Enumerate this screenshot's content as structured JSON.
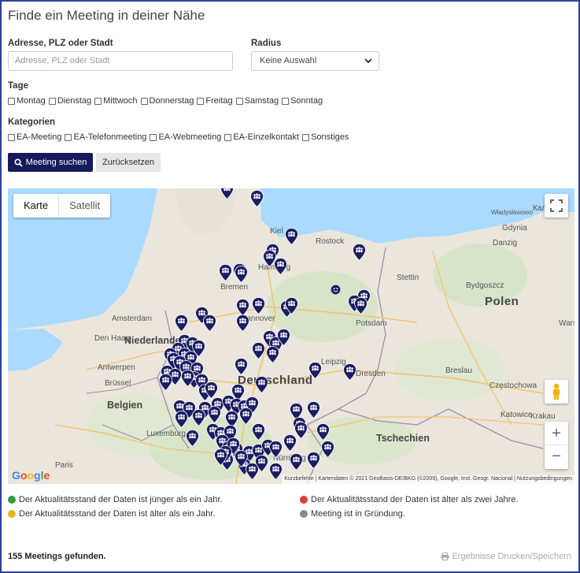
{
  "page": {
    "title": "Finde ein Meeting in deiner Nähe"
  },
  "form": {
    "address_label": "Adresse, PLZ oder Stadt",
    "address_placeholder": "Adresse, PLZ oder Stadt",
    "radius_label": "Radius",
    "radius_value": "Keine Auswahl",
    "days_label": "Tage",
    "days": [
      "Montag",
      "Dienstag",
      "Mittwoch",
      "Donnerstag",
      "Freitag",
      "Samstag",
      "Sonntag"
    ],
    "categories_label": "Kategorien",
    "categories": [
      "EA-Meeting",
      "EA-Telefonmeeting",
      "EA-Webmeeting",
      "EA-Einzelkontakt",
      "Sonstiges"
    ],
    "search_button": "Meeting suchen",
    "reset_button": "Zurücksetzen"
  },
  "map": {
    "type_map": "Karte",
    "type_satellite": "Satellit",
    "brand": "Google",
    "attribution": "Kurzbefehle  |  Kartendaten © 2021 GeoBasis-DE/BKG (©2009), Google, Inst. Geogr. Nacional  |  Nutzungsbedingungen",
    "zoom_in": "+",
    "zoom_out": "−",
    "pin_color": "#1b1d63",
    "labels": {
      "polen": "Polen",
      "deutschland": "Deutschland",
      "niederlande": "Niederlande",
      "belgien": "Belgien",
      "tschechien": "Tschechien",
      "luxemburg": "Luxemburg",
      "paris": "Paris",
      "kiel": "Kiel",
      "rostock": "Rostock",
      "hamburg": "Hamburg",
      "bremen": "Bremen",
      "stettin": "Stettin",
      "gdynia": "Gdynia",
      "danzig": "Danzig",
      "bydgoszcz": "Bydgoszcz",
      "warschau": "Warsch",
      "amsterdam": "Amsterdam",
      "den_haag": "Den Haag",
      "antwerpen": "Antwerpen",
      "brussel": "Brüssel",
      "potsdam": "Potsdam",
      "leipzig": "Leipzig",
      "dresden": "Dresden",
      "breslau": "Breslau",
      "czestochowa": "Częstochowa",
      "katowice": "Katowice",
      "krakau": "Krakau",
      "nurnberg": "Nürnberg",
      "hannover": "Hannover",
      "wladyslawowo": "Władysławowo",
      "kaliningrad": "Калин"
    }
  },
  "legend": {
    "green": "Der Aktualitätsstand der Daten ist jünger als ein Jahr.",
    "red": "Der Aktualitätsstand der Daten ist älter als zwei Jahre.",
    "yellow": "Der Aktualitätsstand der Daten ist älter als ein Jahr.",
    "grey": "Meeting ist in Gründung.",
    "colors": {
      "green": "#2e9e3e",
      "red": "#d9413a",
      "yellow": "#e8b320",
      "grey": "#8a8a8a"
    }
  },
  "results": {
    "count_text": "155 Meetings gefunden.",
    "print_text": "Ergebnisse Drucken/Speichern"
  }
}
